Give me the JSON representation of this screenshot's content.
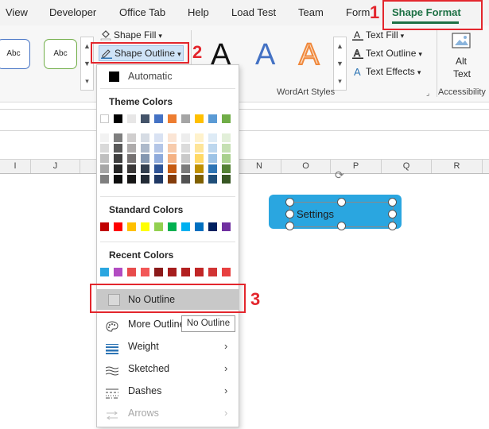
{
  "tabs": [
    {
      "label": "View"
    },
    {
      "label": "Developer"
    },
    {
      "label": "Office Tab"
    },
    {
      "label": "Help"
    },
    {
      "label": "Load Test"
    },
    {
      "label": "Team"
    },
    {
      "label": "Form"
    },
    {
      "label": "Shape Format"
    }
  ],
  "ribbon": {
    "shape_styles": [
      "Abc",
      "Abc"
    ],
    "shape_fill_label": "Shape Fill",
    "shape_outline_label": "Shape Outline",
    "wordart_sample": "A",
    "text_fill_label": "Text Fill",
    "text_outline_label": "Text Outline",
    "text_effects_label": "Text Effects",
    "wordart_group_label": "WordArt Styles",
    "alt_text_label_1": "Alt",
    "alt_text_label_2": "Text",
    "accessibility_label": "Accessibility"
  },
  "columns": [
    "I",
    "J",
    "",
    "",
    "",
    "N",
    "O",
    "P",
    "Q",
    "R"
  ],
  "shape": {
    "text": "Settings",
    "fill": "#2aa6e0"
  },
  "menu": {
    "automatic_label": "Automatic",
    "theme_colors_label": "Theme Colors",
    "theme_top_row": [
      "#ffffff",
      "#000000",
      "#e7e6e6",
      "#44546a",
      "#4472c4",
      "#ed7d31",
      "#a5a5a5",
      "#ffc000",
      "#5b9bd5",
      "#70ad47"
    ],
    "theme_shades": [
      [
        "#f2f2f2",
        "#d9d9d9",
        "#bfbfbf",
        "#a6a6a6",
        "#7f7f7f"
      ],
      [
        "#7f7f7f",
        "#595959",
        "#3f3f3f",
        "#262626",
        "#0d0d0d"
      ],
      [
        "#d0cece",
        "#aeabab",
        "#757171",
        "#3a3838",
        "#171616"
      ],
      [
        "#d6dce4",
        "#adb9ca",
        "#8497b0",
        "#333f4f",
        "#222a35"
      ],
      [
        "#d9e2f3",
        "#b4c6e7",
        "#8eaadb",
        "#2f5496",
        "#1f3864"
      ],
      [
        "#fbe5d5",
        "#f7cbac",
        "#f4b183",
        "#c55a11",
        "#833c0b"
      ],
      [
        "#ededed",
        "#dbdbdb",
        "#c9c9c9",
        "#7b7b7b",
        "#525252"
      ],
      [
        "#fff2cc",
        "#fee599",
        "#ffd965",
        "#bf9000",
        "#7f6000"
      ],
      [
        "#deebf6",
        "#bdd7ee",
        "#9dc3e6",
        "#2e75b5",
        "#1f4e79"
      ],
      [
        "#e2efd9",
        "#c5e0b3",
        "#a8d08d",
        "#538135",
        "#375623"
      ]
    ],
    "standard_colors_label": "Standard Colors",
    "standard_colors": [
      "#c00000",
      "#ff0000",
      "#ffc000",
      "#ffff00",
      "#92d050",
      "#00b050",
      "#00b0f0",
      "#0070c0",
      "#002060",
      "#7030a0"
    ],
    "recent_colors_label": "Recent Colors",
    "recent_colors": [
      "#2aa6e0",
      "#b24cc2",
      "#e84c4c",
      "#f25757",
      "#8b1a1a",
      "#a61d1d",
      "#b32020",
      "#c12626",
      "#d13434",
      "#e84040"
    ],
    "no_outline_label": "No Outline",
    "more_outline_label": "More Outline",
    "weight_label": "Weight",
    "sketched_label": "Sketched",
    "dashes_label": "Dashes",
    "arrows_label": "Arrows"
  },
  "tooltip": "No Outline",
  "callouts": [
    "1",
    "2",
    "3"
  ]
}
